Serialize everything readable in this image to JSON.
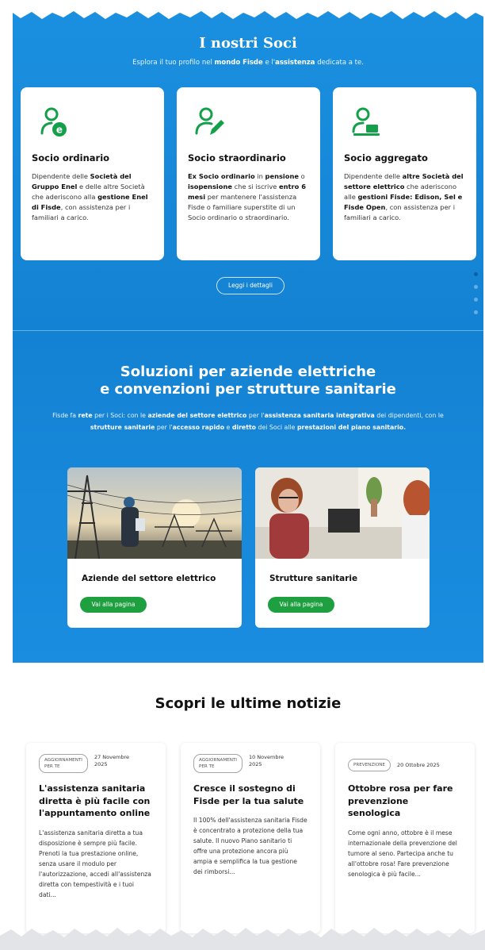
{
  "soci": {
    "title": "I nostri Soci",
    "subtitle_parts": [
      "Esplora il tuo profilo nel ",
      "mondo Fisde",
      " e l'",
      "assistenza",
      " dedicata a te."
    ],
    "cards": [
      {
        "icon": "user-enel-icon",
        "title": "Socio ordinario",
        "desc": [
          {
            "t": "Dipendente delle ",
            "b": false
          },
          {
            "t": "Società del Gruppo Enel",
            "b": true
          },
          {
            "t": " e delle altre Società che aderiscono alla ",
            "b": false
          },
          {
            "t": "gestione Enel di Fisde",
            "b": true
          },
          {
            "t": ", con assistenza per i familiari a carico.",
            "b": false
          }
        ]
      },
      {
        "icon": "user-edit-icon",
        "title": "Socio straordinario",
        "desc": [
          {
            "t": "Ex Socio ordinario",
            "b": true
          },
          {
            "t": " in ",
            "b": false
          },
          {
            "t": "pensione",
            "b": true
          },
          {
            "t": " o ",
            "b": false
          },
          {
            "t": "isopensione",
            "b": true
          },
          {
            "t": " che si iscrive ",
            "b": false
          },
          {
            "t": "entro 6 mesi",
            "b": true
          },
          {
            "t": " per mantenere l'assistenza Fisde o familiare superstite di un Socio ordinario o straordinario.",
            "b": false
          }
        ]
      },
      {
        "icon": "user-laptop-icon",
        "title": "Socio aggregato",
        "desc": [
          {
            "t": "Dipendente delle ",
            "b": false
          },
          {
            "t": "altre Società del settore elettrico",
            "b": true
          },
          {
            "t": " che aderiscono alle ",
            "b": false
          },
          {
            "t": "gestioni Fisde: Edison, Sel e Fisde Open",
            "b": true
          },
          {
            "t": ", con assistenza per i familiari a carico.",
            "b": false
          }
        ]
      }
    ],
    "details_button": "Leggi i dettagli",
    "carousel": {
      "count": 4,
      "active": 0
    }
  },
  "soluzioni": {
    "title_line1": "Soluzioni per aziende elettriche",
    "title_line2": "e convenzioni per strutture sanitarie",
    "desc": [
      {
        "t": "Fisde fa ",
        "b": false
      },
      {
        "t": "rete",
        "b": true
      },
      {
        "t": " per i Soci: con le ",
        "b": false
      },
      {
        "t": "aziende del settore elettrico",
        "b": true
      },
      {
        "t": " per l'",
        "b": false
      },
      {
        "t": "assistenza sanitaria integrativa",
        "b": true
      },
      {
        "t": " dei dipendenti, con le ",
        "b": false
      },
      {
        "t": "strutture sanitarie",
        "b": true
      },
      {
        "t": " per l'",
        "b": false
      },
      {
        "t": "accesso rapido",
        "b": true
      },
      {
        "t": " e ",
        "b": false
      },
      {
        "t": "diretto",
        "b": true
      },
      {
        "t": " dei Soci alle ",
        "b": false
      },
      {
        "t": "prestazioni del piano sanitario.",
        "b": true
      }
    ],
    "cards": [
      {
        "title": "Aziende del settore elettrico",
        "button": "Vai alla pagina"
      },
      {
        "title": "Strutture sanitarie",
        "button": "Vai alla pagina"
      }
    ]
  },
  "news": {
    "title": "Scopri le ultime notizie",
    "items": [
      {
        "tag_line1": "AGGIORNAMENTI",
        "tag_line2": "PER TE",
        "date_line1": "27 Novembre",
        "date_line2": "2025",
        "title": "L'assistenza sanitaria diretta è più facile con l'appuntamento online",
        "text": "L'assistenza sanitaria diretta a tua disposizione è sempre più facile. Prenoti la tua prestazione online, senza usare il modulo per l'autorizzazione, accedi all'assistenza diretta con tempestività e i tuoi dati..."
      },
      {
        "tag_line1": "AGGIORNAMENTI",
        "tag_line2": "PER TE",
        "date_line1": "10 Novembre",
        "date_line2": "2025",
        "title": "Cresce il sostegno di Fisde per la tua salute",
        "text": "Il 100% dell'assistenza sanitaria Fisde è concentrato a protezione della tua salute. Il nuovo Piano sanitario ti offre una protezione ancora più ampia e semplifica la tua gestione dei rimborsi..."
      },
      {
        "tag_line1": "PREVENZIONE",
        "tag_line2": "",
        "date_line1": "20 Ottobre 2025",
        "date_line2": "",
        "title": "Ottobre rosa per fare prevenzione senologica",
        "text": "Come ogni anno, ottobre è il mese internazionale della prevenzione del tumore al seno. Partecipa anche tu all'ottobre rosa! Fare prevenzione senologica è più facile..."
      }
    ]
  },
  "colors": {
    "brand_blue": "#1689d9",
    "accent_green": "#1fa040",
    "icon_green": "#14a04a"
  }
}
